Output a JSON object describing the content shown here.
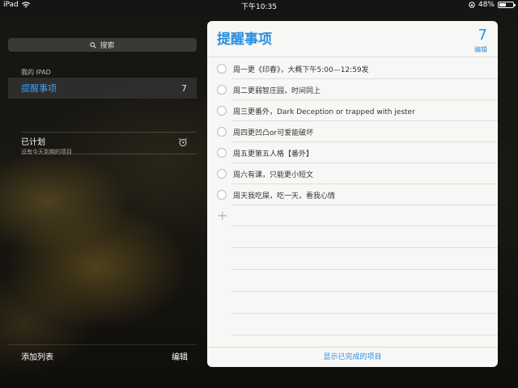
{
  "status_bar": {
    "device": "iPad",
    "time": "下午10:35",
    "battery_percent": "48%",
    "battery_level": 0.48
  },
  "sidebar": {
    "search_placeholder": "搜索",
    "section_header": "我的 IPAD",
    "lists": [
      {
        "name": "提醒事项",
        "count": "7"
      }
    ],
    "scheduled": {
      "title": "已计划",
      "subtitle": "没有今天到期的项目"
    },
    "footer": {
      "add_list": "添加列表",
      "edit": "编辑"
    }
  },
  "panel": {
    "title": "提醒事项",
    "count": "7",
    "edit": "编辑",
    "items": [
      "周一更《印春》，大概下午5:00—12:59发",
      "周二更弱智庄园，时间同上",
      "周三更番外，Dark Deception or trapped with jester",
      "周四更凹凸or可爱能破坏",
      "周五更第五人格【番外】",
      "周六有课，只能更小短文",
      "周天我吃屎，吃一天，看我心情"
    ],
    "show_completed": "显示已完成的项目"
  },
  "colors": {
    "accent": "#2a8fe0",
    "sidebar_selected_text": "#3ba0f3",
    "panel_bg": "#f7f7f5"
  },
  "icons": [
    "wifi-icon",
    "search-icon",
    "alarm-clock-icon",
    "rotation-lock-icon",
    "plus-icon",
    "checkbox-circle-icon"
  ]
}
